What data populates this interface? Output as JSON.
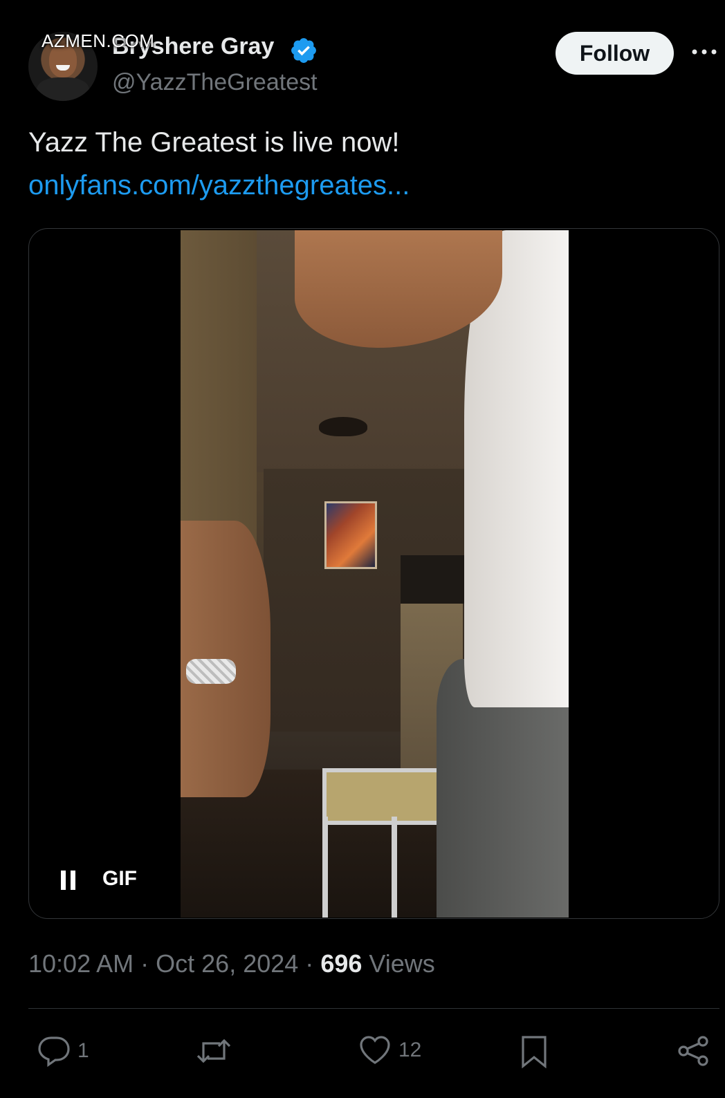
{
  "watermark": "AZMEN.COM",
  "author": {
    "display_name": "Bryshere Gray",
    "handle": "@YazzTheGreatest",
    "verified_icon": "verified-badge-icon",
    "avatar": "avatar"
  },
  "header": {
    "follow_label": "Follow",
    "more_icon": "more-dots-icon"
  },
  "tweet": {
    "text": "Yazz The Greatest is live now!",
    "link_text": "onlyfans.com/yazzthegreates..."
  },
  "media": {
    "type_label": "GIF",
    "pause_icon": "pause-icon"
  },
  "meta": {
    "time": "10:02 AM",
    "sep": "·",
    "date": "Oct 26, 2024",
    "views_count": "696",
    "views_label": "Views"
  },
  "actions": {
    "reply_count": "1",
    "retweet_count": "",
    "like_count": "12",
    "icons": [
      "reply-icon",
      "retweet-icon",
      "like-icon",
      "bookmark-icon",
      "share-icon"
    ]
  },
  "colors": {
    "background": "#000000",
    "text": "#e7e9ea",
    "muted": "#71767b",
    "link": "#1d9bf0",
    "verified": "#1d9bf0",
    "follow_bg": "#eff3f4"
  }
}
